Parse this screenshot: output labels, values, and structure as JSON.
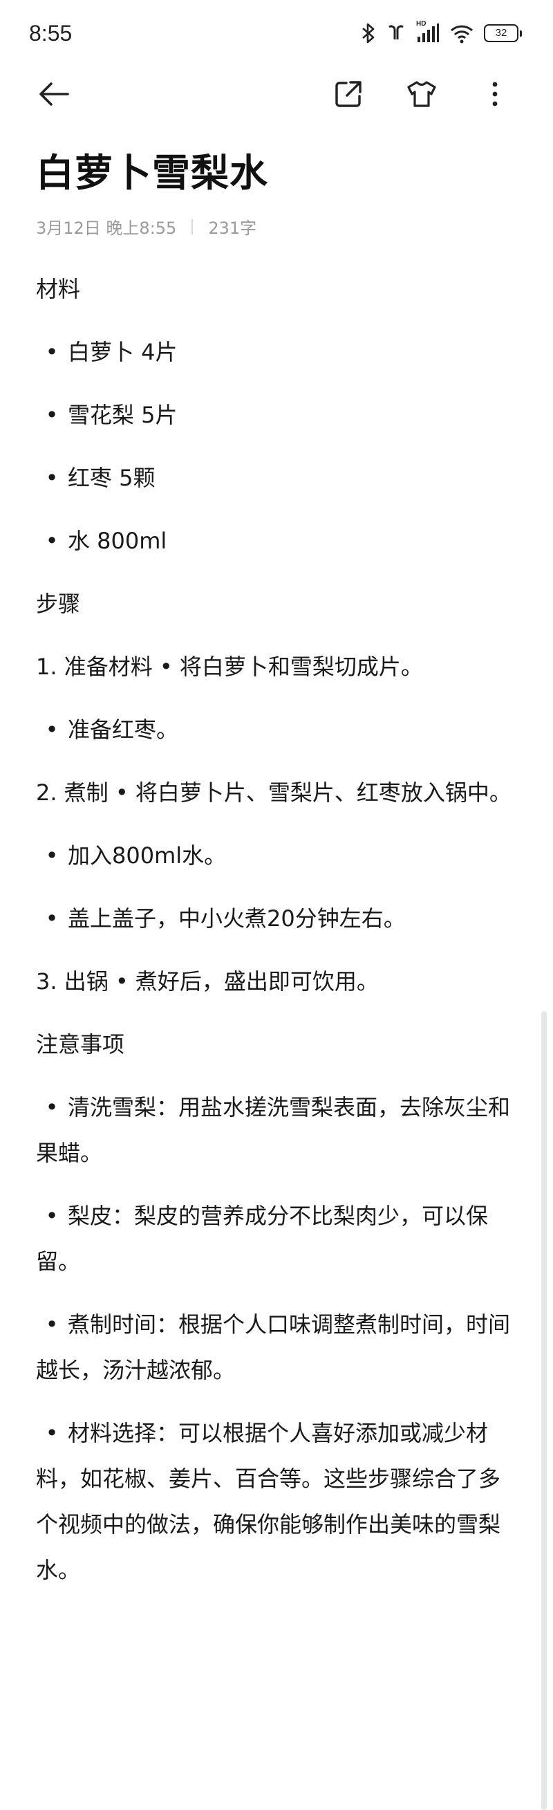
{
  "status": {
    "time": "8:55",
    "battery": "32",
    "hd_label": "HD"
  },
  "icons": {
    "back": "arrow-left-icon",
    "share": "share-icon",
    "theme": "t-shirt-icon",
    "more": "more-vertical-icon"
  },
  "note": {
    "title": "白萝卜雪梨水",
    "date": "3月12日 晚上8:55",
    "char_count": "231字",
    "lines": [
      "材料",
      "白萝卜 4片",
      "雪花梨 5片",
      "红枣 5颗",
      "水 800ml",
      "步骤",
      "1. 准备材料 • 将白萝卜和雪梨切成片。",
      "准备红枣。",
      "2. 煮制 • 将白萝卜片、雪梨片、红枣放入锅中。",
      "加入800ml水。",
      "盖上盖子，中小火煮20分钟左右。",
      "3. 出锅 • 煮好后，盛出即可饮用。",
      "注意事项",
      "清洗雪梨：用盐水搓洗雪梨表面，去除灰尘和果蜡。",
      "梨皮：梨皮的营养成分不比梨肉少，可以保留。",
      "煮制时间：根据个人口味调整煮制时间，时间越长，汤汁越浓郁。",
      "材料选择：可以根据个人喜好添加或减少材料，如花椒、姜片、百合等。这些步骤综合了多个视频中的做法，确保你能够制作出美味的雪梨水。"
    ],
    "bullet": "•"
  }
}
